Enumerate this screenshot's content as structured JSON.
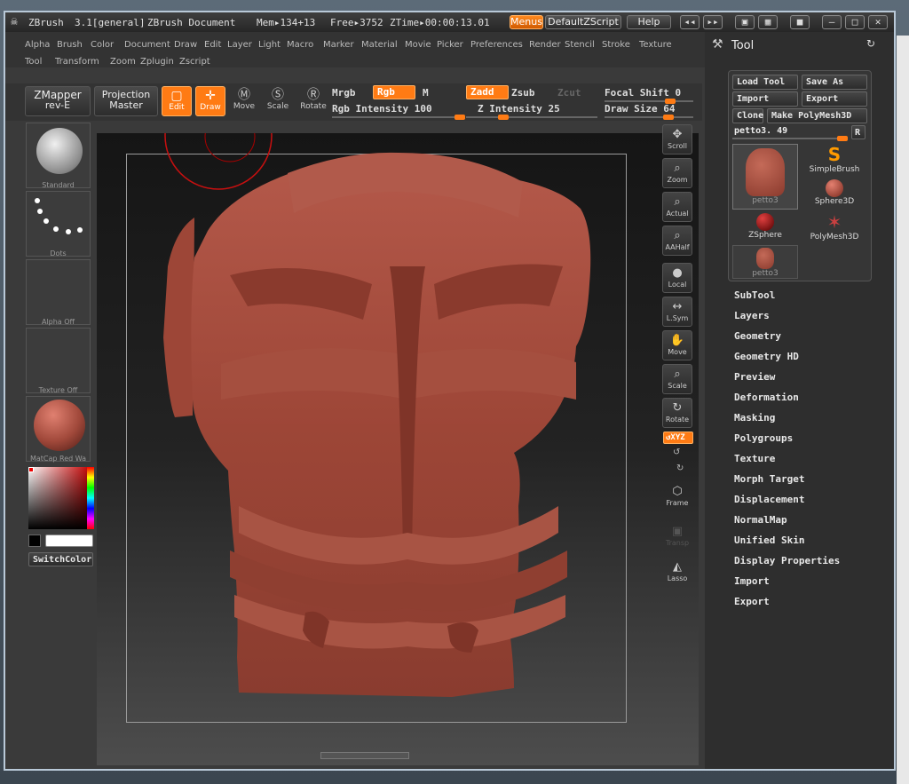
{
  "titlebar": {
    "app": "ZBrush",
    "version": "3.1[general]",
    "document": "ZBrush Document",
    "mem": "Mem▸134+13",
    "free": "Free▸3752",
    "ztime": "ZTime▸00:00:13.01",
    "menus_btn": "Menus",
    "script_btn": "DefaultZScript",
    "help_btn": "Help"
  },
  "menu": {
    "row1": [
      "Alpha",
      "Brush",
      "Color",
      "Document",
      "Draw",
      "Edit",
      "Layer",
      "Light",
      "Macro",
      "Marker",
      "Material",
      "Movie",
      "Picker",
      "Preferences",
      "Render",
      "Stencil",
      "Stroke",
      "Texture"
    ],
    "row2": [
      "Tool",
      "Transform",
      "Zoom",
      "Zplugin",
      "Zscript"
    ]
  },
  "toolbar": {
    "zmapper": "ZMapper",
    "zmapper2": "rev-E",
    "projection": "Projection",
    "projection2": "Master",
    "edit": "Edit",
    "draw": "Draw",
    "move": "Move",
    "scale": "Scale",
    "rotate": "Rotate",
    "mrgb": "Mrgb",
    "rgb": "Rgb",
    "m": "M",
    "rgb_intensity": "Rgb Intensity 100",
    "zadd": "Zadd",
    "zsub": "Zsub",
    "zcut": "Zcut",
    "z_intensity": "Z Intensity 25",
    "focal_shift": "Focal Shift 0",
    "draw_size": "Draw Size 64"
  },
  "leftshelf": {
    "brush": "Standard",
    "stroke": "Dots",
    "alpha": "Alpha Off",
    "texture": "Texture Off",
    "material": "MatCap Red Wa",
    "switch_color": "SwitchColor"
  },
  "rightshelf": [
    "Scroll",
    "Zoom",
    "Actual",
    "AAHalf",
    "Local",
    "L.Sym",
    "Move",
    "Scale",
    "Rotate",
    "XYZ",
    "Frame",
    "Transp",
    "Lasso"
  ],
  "tool": {
    "title": "Tool",
    "load_tool": "Load Tool",
    "save_as": "Save As",
    "import": "Import",
    "export": "Export",
    "clone": "Clone",
    "make_polymesh": "Make PolyMesh3D",
    "current": "petto3. 49",
    "r": "R",
    "items": [
      "petto3",
      "SimpleBrush",
      "Sphere3D",
      "ZSphere",
      "PolyMesh3D",
      "petto3"
    ],
    "subpalettes": [
      "SubTool",
      "Layers",
      "Geometry",
      "Geometry HD",
      "Preview",
      "Deformation",
      "Masking",
      "Polygroups",
      "Texture",
      "Morph Target",
      "Displacement",
      "NormalMap",
      "Unified Skin",
      "Display Properties",
      "Import",
      "Export"
    ]
  },
  "colors": {
    "accent": "#ff7b14",
    "clay": "#a0483a"
  }
}
